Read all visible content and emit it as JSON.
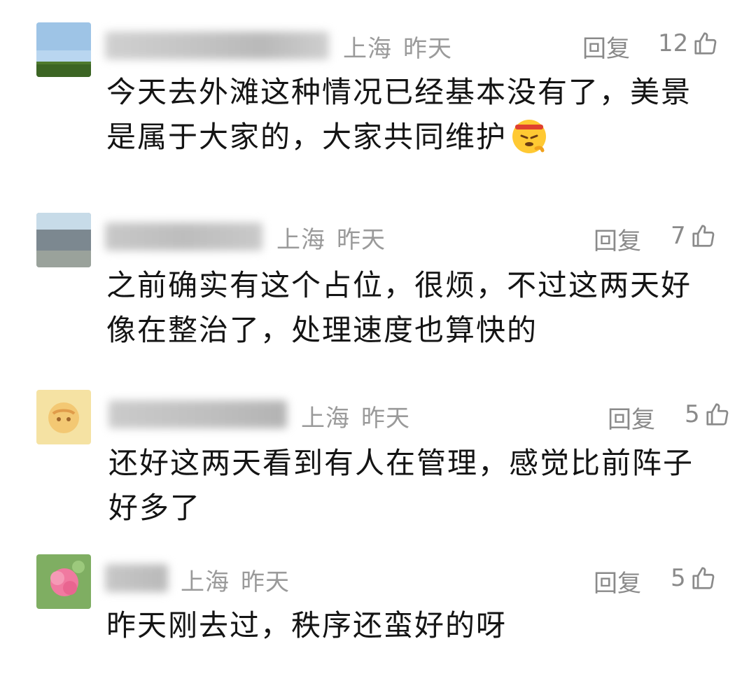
{
  "comments": [
    {
      "location": "上海",
      "time": "昨天",
      "reply_label": "回复",
      "likes": "12",
      "text_lines": [
        "今天去外滩这种情况已经基本没有了，美景",
        "是属于大家的，大家共同维护"
      ],
      "avatar_icon": "landscape-avatar",
      "trailing_emoji": "angry-face-emoji"
    },
    {
      "location": "上海",
      "time": "昨天",
      "reply_label": "回复",
      "likes": "7",
      "text_lines": [
        "之前确实有这个占位，很烦，不过这两天好",
        "像在整治了，处理速度也算快的"
      ],
      "avatar_icon": "street-avatar"
    },
    {
      "location": "上海",
      "time": "昨天",
      "reply_label": "回复",
      "likes": "5",
      "text_lines": [
        "还好这两天看到有人在管理，感觉比前阵子",
        "好多了"
      ],
      "avatar_icon": "cartoon-avatar"
    },
    {
      "location": "上海",
      "time": "昨天",
      "reply_label": "回复",
      "likes": "5",
      "text_lines": [
        "昨天刚去过，秩序还蛮好的呀"
      ],
      "avatar_icon": "flower-avatar"
    }
  ],
  "icons": {
    "like": "thumbs-up-icon",
    "name": "blurred-username"
  },
  "colors": {
    "meta": "#9a9a9a",
    "text": "#141414",
    "background": "#ffffff"
  }
}
